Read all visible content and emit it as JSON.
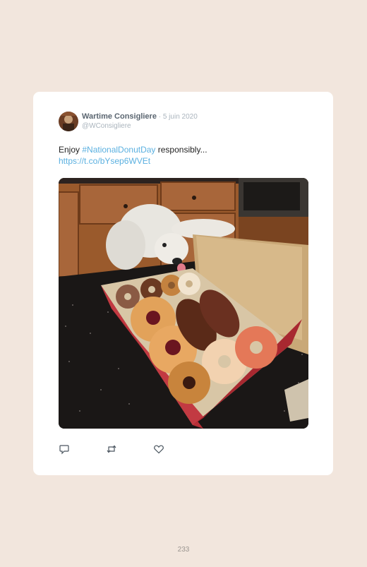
{
  "tweet": {
    "author_name": "Wartime Consigliere",
    "separator": " · ",
    "date": "5 juin 2020",
    "handle": "@WConsigliere",
    "text_before": "Enjoy ",
    "hashtag": "#NationalDonutDay",
    "text_after": " responsibly...",
    "url": "https://t.co/bYsep6WVEt"
  },
  "actions": {
    "reply_icon": "reply-icon",
    "retweet_icon": "retweet-icon",
    "like_icon": "heart-icon"
  },
  "colors": {
    "background": "#f2e6dd",
    "card": "#ffffff",
    "link": "#5ab0e0",
    "name": "#5a6570",
    "muted": "#aab4bd"
  },
  "footer": {
    "page_number": "233"
  }
}
